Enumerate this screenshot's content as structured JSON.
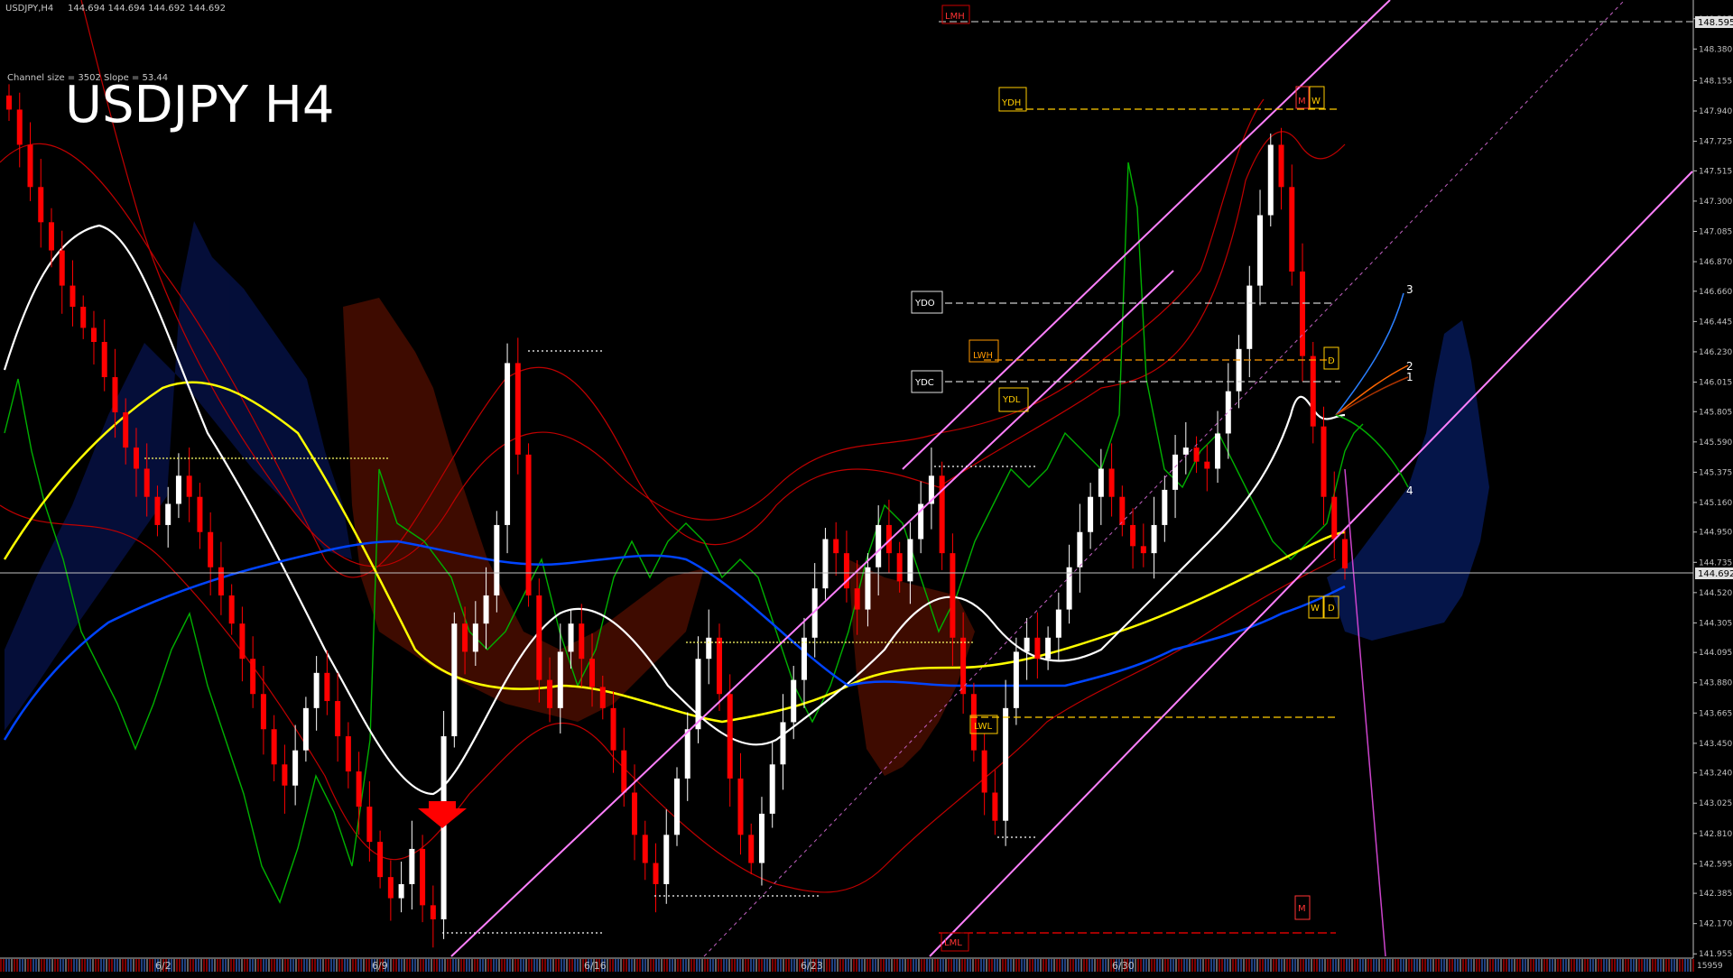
{
  "window": {
    "symbol_info": "USDJPY,H4",
    "ohlc": "144.694 144.694 144.692 144.692",
    "channel_info": "Channel size = 3502 Slope = 53.44",
    "title": "USDJPY H4"
  },
  "price_axis": {
    "labels": [
      "148.595",
      "148.380",
      "148.155",
      "147.940",
      "147.725",
      "147.515",
      "147.300",
      "147.085",
      "146.870",
      "146.660",
      "146.445",
      "146.230",
      "146.015",
      "145.805",
      "145.590",
      "145.375",
      "145.160",
      "144.950",
      "144.735",
      "144.520",
      "144.305",
      "144.095",
      "143.880",
      "143.665",
      "143.450",
      "143.240",
      "143.025",
      "142.810",
      "142.595",
      "142.385",
      "142.170",
      "141.955"
    ],
    "top_tag": "148.595",
    "current_price_tag": "144.692",
    "bottom_value": "15959"
  },
  "date_axis": {
    "labels": [
      "6/2",
      "6/9",
      "6/16",
      "6/23",
      "6/30"
    ]
  },
  "level_labels": {
    "lmh": "LMH",
    "ydh": "YDH",
    "ydo": "YDO",
    "lwh": "LWH",
    "ydc": "YDC",
    "ydl": "YDL",
    "lwl": "LWL",
    "lml": "LML",
    "m_top": "M",
    "w_top": "W",
    "d_upper": "D",
    "w_lower": "W",
    "d_lower": "D",
    "m_bottom": "M"
  },
  "projection_labels": {
    "p1": "1",
    "p2": "2",
    "p3": "3",
    "p4": "4"
  },
  "colors": {
    "bull_candle": "#ffffff",
    "bear_candle": "#ff0000",
    "channel": "#ff80ff",
    "level_line": "#ffcc00",
    "ma_white": "#ffffff",
    "ma_yellow": "#ffff00",
    "ma_blue": "#0000ff",
    "chikou": "#00c000",
    "bollinger": "#d00000"
  },
  "chart_data": {
    "type": "candlestick",
    "instrument": "USDJPY",
    "timeframe": "H4",
    "ylim": [
      141.95,
      148.6
    ],
    "current_price": 144.692,
    "x_labels": [
      "6/2",
      "6/9",
      "6/16",
      "6/23",
      "6/30"
    ],
    "levels": {
      "YDH": 147.96,
      "YDO": 146.66,
      "LWH": 146.24,
      "YDC": 146.08,
      "LWL": 143.66,
      "LML": 142.12
    },
    "closes": [
      147.95,
      147.7,
      147.4,
      147.15,
      146.95,
      146.7,
      146.55,
      146.4,
      146.3,
      146.05,
      145.8,
      145.55,
      145.4,
      145.2,
      145.0,
      145.15,
      145.35,
      145.2,
      144.95,
      144.7,
      144.5,
      144.3,
      144.05,
      143.8,
      143.55,
      143.3,
      143.15,
      143.4,
      143.7,
      143.95,
      143.75,
      143.5,
      143.25,
      143.0,
      142.75,
      142.5,
      142.35,
      142.45,
      142.7,
      142.3,
      142.2,
      143.5,
      144.3,
      144.1,
      144.3,
      144.5,
      145.0,
      146.15,
      145.5,
      144.5,
      143.9,
      143.7,
      144.1,
      144.3,
      144.05,
      143.85,
      143.7,
      143.4,
      143.1,
      142.8,
      142.6,
      142.45,
      142.8,
      143.2,
      143.55,
      144.05,
      144.2,
      143.8,
      143.2,
      142.8,
      142.6,
      142.95,
      143.3,
      143.6,
      143.9,
      144.2,
      144.55,
      144.9,
      144.8,
      144.55,
      144.4,
      144.7,
      145.0,
      144.8,
      144.6,
      144.9,
      145.15,
      145.35,
      144.8,
      144.2,
      143.8,
      143.4,
      143.1,
      142.9,
      143.7,
      144.1,
      144.2,
      144.05,
      144.2,
      144.4,
      144.7,
      144.95,
      145.2,
      145.4,
      145.2,
      145.0,
      144.85,
      144.8,
      145.0,
      145.25,
      145.5,
      145.55,
      145.45,
      145.4,
      145.65,
      145.95,
      146.25,
      146.7,
      147.2,
      147.7,
      147.4,
      146.8,
      146.2,
      145.7,
      145.2,
      144.9,
      144.692
    ]
  }
}
